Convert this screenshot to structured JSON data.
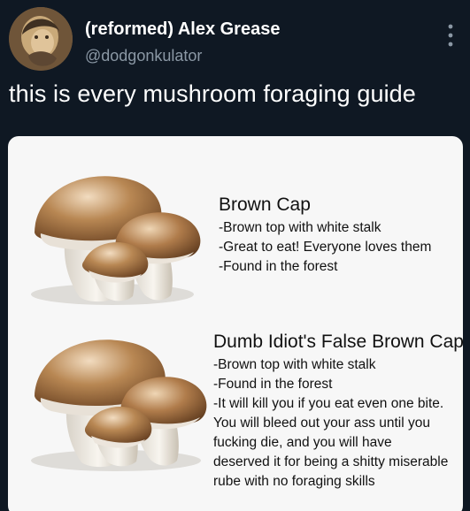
{
  "tweet": {
    "display_name": "(reformed) Alex Grease",
    "handle": "@dodgonkulator",
    "text": "this is every mushroom foraging guide",
    "more_icon": "more-vertical-icon"
  },
  "colors": {
    "background": "#0f1823",
    "card_background": "#f7f7f7",
    "primary_text": "#ffffff",
    "secondary_text": "#8b98a5",
    "card_text": "#111111"
  },
  "guide": {
    "entries": [
      {
        "name": "Brown Cap",
        "lines": [
          "-Brown top with white stalk",
          "-Great to eat! Everyone loves them",
          "-Found in the forest"
        ]
      },
      {
        "name": "Dumb Idiot's False Brown Cap",
        "lines": [
          "-Brown top with white stalk",
          "-Found in the forest",
          "-It will kill you if you eat even one bite. You will bleed out your ass until you fucking die, and you will have deserved it for being a shitty miserable rube with no foraging skills"
        ]
      }
    ]
  }
}
